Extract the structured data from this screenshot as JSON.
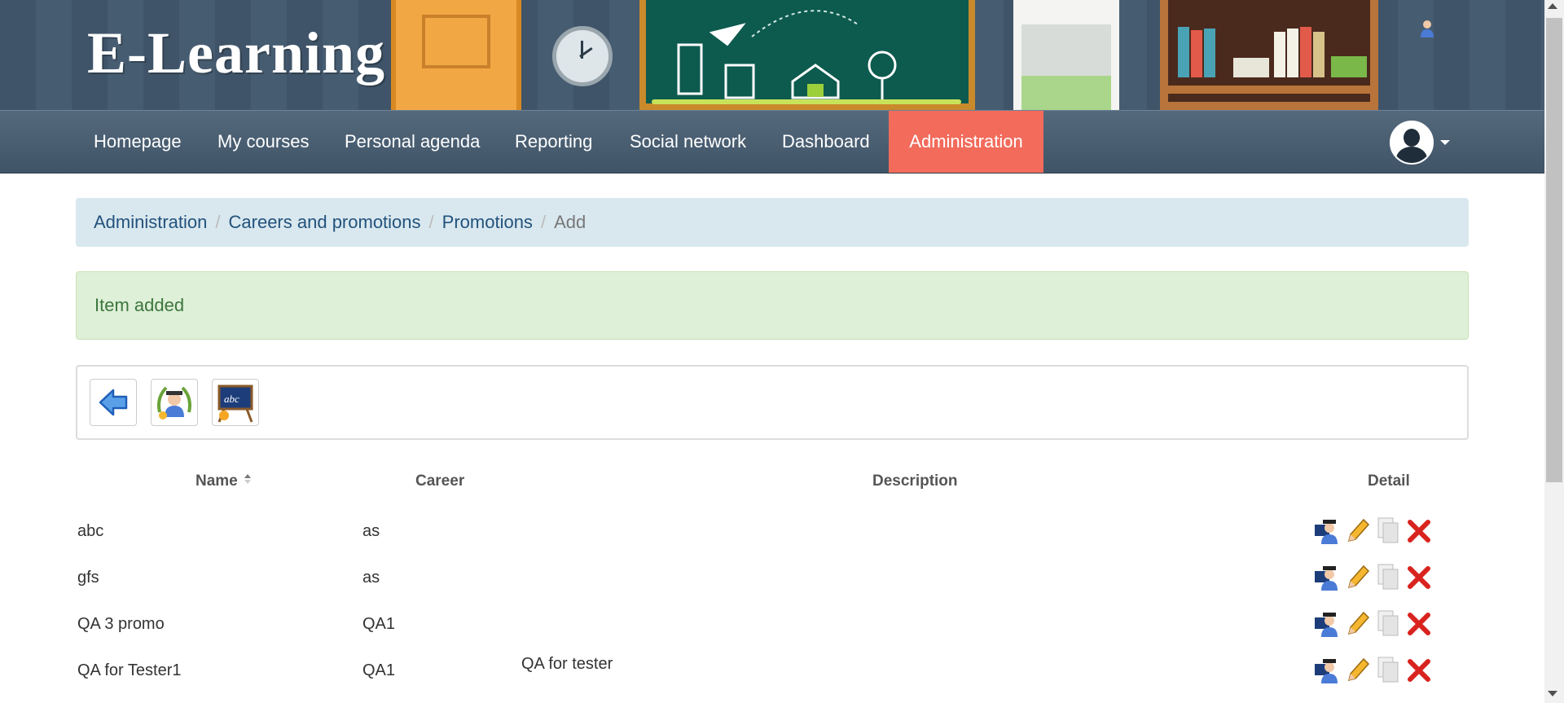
{
  "app": {
    "logo_text": "E-Learning"
  },
  "nav": {
    "items": [
      {
        "label": "Homepage"
      },
      {
        "label": "My courses"
      },
      {
        "label": "Personal agenda"
      },
      {
        "label": "Reporting"
      },
      {
        "label": "Social network"
      },
      {
        "label": "Dashboard"
      },
      {
        "label": "Administration",
        "active": true
      }
    ],
    "active_color": "#f26b5b"
  },
  "breadcrumb": {
    "items": [
      "Administration",
      "Careers and promotions",
      "Promotions"
    ],
    "current": "Add",
    "separator": "/"
  },
  "alert": {
    "message": "Item added",
    "type": "success"
  },
  "toolbar": {
    "buttons": [
      {
        "icon": "back-arrow-icon"
      },
      {
        "icon": "careers-icon"
      },
      {
        "icon": "promotions-icon"
      }
    ]
  },
  "table": {
    "columns": [
      "Name",
      "Career",
      "Description",
      "Detail"
    ],
    "sort_column": "Name",
    "rows": [
      {
        "name": "abc",
        "career": "as",
        "description": ""
      },
      {
        "name": "gfs",
        "career": "as",
        "description": ""
      },
      {
        "name": "QA 3 promo",
        "career": "QA1",
        "description": ""
      },
      {
        "name": "QA for Tester1",
        "career": "QA1",
        "description": "QA for tester"
      }
    ],
    "row_actions": [
      "subscribe-sessions-icon",
      "edit-pencil-icon",
      "copy-icon",
      "delete-icon"
    ]
  }
}
